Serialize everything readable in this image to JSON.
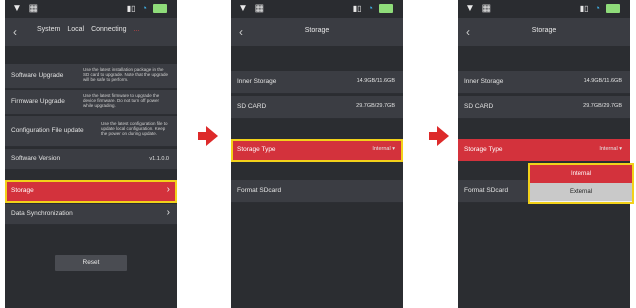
{
  "status": {
    "left": "▼ ▦",
    "signal": "▭ₗₗ",
    "wifi": "Wi‑Fi"
  },
  "screen1": {
    "back": "‹",
    "tabs": [
      "System",
      "Local",
      "Connecting",
      "..."
    ],
    "rows": [
      {
        "label": "Software Upgrade",
        "desc": "Use the latest installation package in the SD card to upgrade. Note that the upgrade will be safe to perform."
      },
      {
        "label": "Firmware Upgrade",
        "desc": "Use the latest firmware to upgrade the device firmware. Do not turn off power while upgrading."
      },
      {
        "label": "Configuration File update",
        "desc": "Use the latest configuration file to update local configuration. Keep the power on during update."
      },
      {
        "label": "Software Version",
        "value": "v1.1.0.0"
      },
      {
        "label": "Storage"
      },
      {
        "label": "Data Synchronization"
      }
    ],
    "reset": "Reset"
  },
  "screen2": {
    "title": "Storage",
    "inner_label": "Inner Storage",
    "inner_value": "14.9GB/11.6GB",
    "sd_label": "SD CARD",
    "sd_value": "29.7GB/29.7GB",
    "type_label": "Storage Type",
    "type_value": "Internal",
    "format_label": "Format SDcard"
  },
  "screen3": {
    "title": "Storage",
    "inner_label": "Inner Storage",
    "inner_value": "14.9GB/11.6GB",
    "sd_label": "SD CARD",
    "sd_value": "29.7GB/29.7GB",
    "type_label": "Storage Type",
    "type_value": "Internal",
    "format_label": "Format SDcard",
    "options": [
      "Internal",
      "External"
    ]
  },
  "colors": {
    "accent": "#d3323c",
    "highlight": "#f2d11a",
    "arrow": "#dd2a2a"
  }
}
